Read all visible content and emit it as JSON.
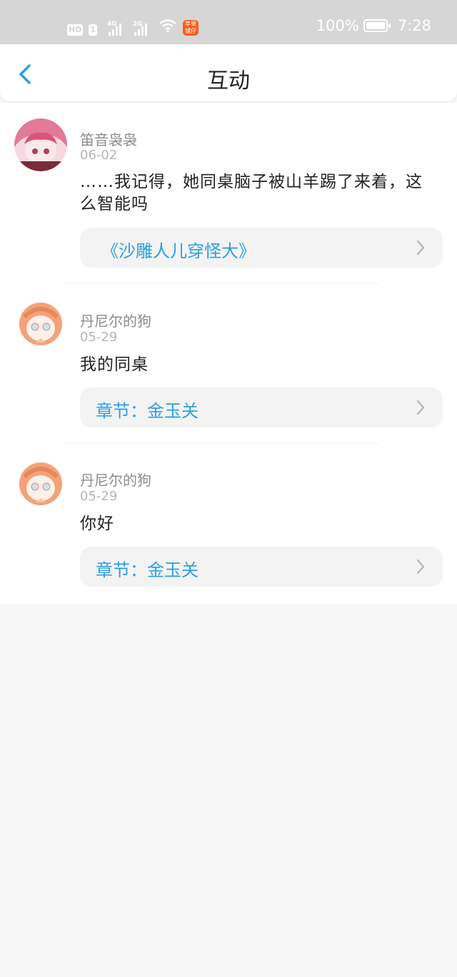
{
  "status_bar": {
    "hd_label": "HD",
    "sim_label": "1",
    "net1_label": "4G",
    "net2_label": "2G",
    "app_badge_label": "苹果 铺仔",
    "battery_text": "100%",
    "time": "7:28"
  },
  "header": {
    "title": "互动",
    "back_icon": "chevron-left-icon"
  },
  "colors": {
    "accent": "#2a9fe3",
    "status_bar_bg": "#d6d6d6"
  },
  "items": [
    {
      "username": "笛音袅袅",
      "date": "06-02",
      "content": "……我记得，她同桌脑子被山羊踢了来着，这么智能吗",
      "link_text": "《沙雕人儿穿怪大》"
    },
    {
      "username": "丹尼尔的狗",
      "date": "05-29",
      "content": "我的同桌",
      "link_text": "章节：金玉关"
    },
    {
      "username": "丹尼尔的狗",
      "date": "05-29",
      "content": "你好",
      "link_text": "章节：金玉关"
    }
  ]
}
